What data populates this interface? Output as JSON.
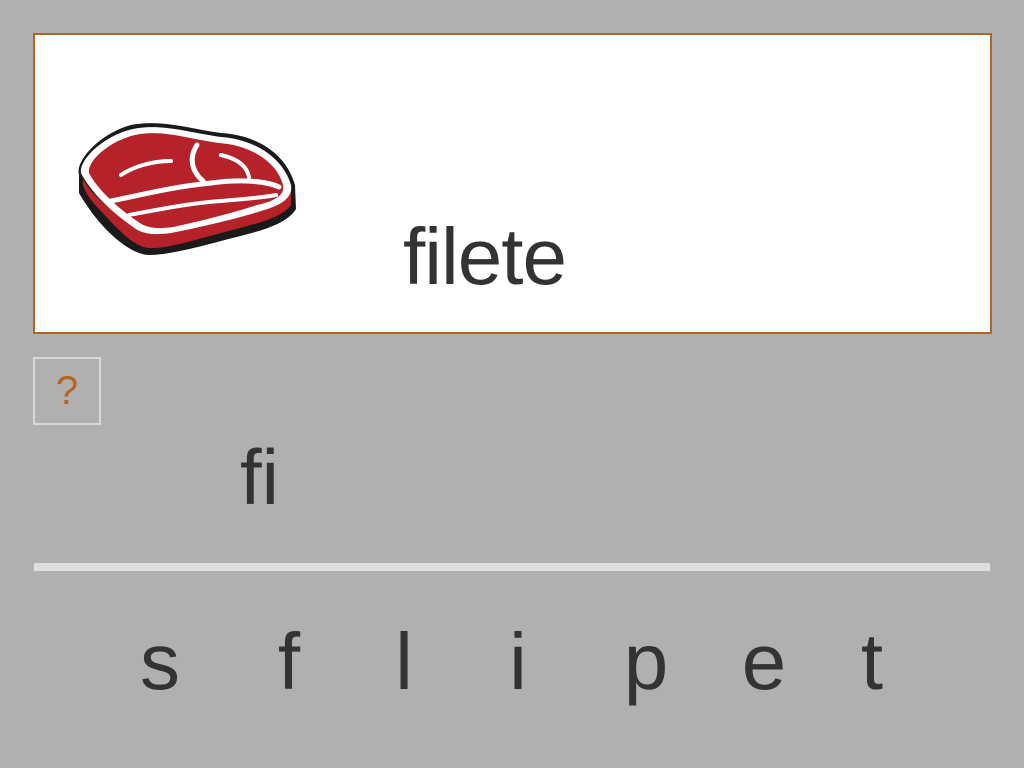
{
  "card": {
    "image": "meat-steak-icon",
    "word": "filete"
  },
  "hint": {
    "label": "?"
  },
  "answer": {
    "text": "fi"
  },
  "letters": [
    "s",
    "f",
    "l",
    "i",
    "p",
    "e",
    "t"
  ],
  "colors": {
    "background": "#b0b0b0",
    "card_border": "#b5651d",
    "text": "#333333",
    "hint": "#b5651d",
    "meat_red": "#b5222a"
  }
}
